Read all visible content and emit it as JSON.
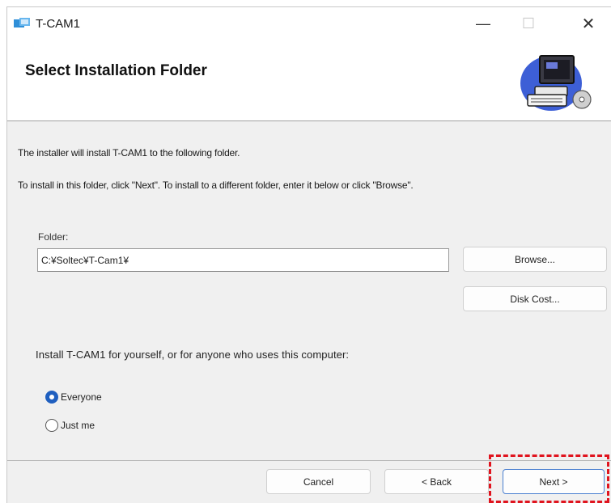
{
  "window": {
    "title": "T-CAM1",
    "minimize_glyph": "—",
    "maximize_glyph": "☐",
    "close_glyph": "✕"
  },
  "header": {
    "title": "Select Installation Folder",
    "art_icon": "computer-cd-icon"
  },
  "body": {
    "intro": "The installer will install T-CAM1 to the following folder.",
    "instructions": "To install in this folder, click \"Next\". To install to a different folder, enter it below or click \"Browse\"."
  },
  "folder": {
    "label": "Folder:",
    "value": "C:¥Soltec¥T-Cam1¥"
  },
  "buttons": {
    "browse": "Browse...",
    "disk_cost": "Disk Cost...",
    "cancel": "Cancel",
    "back": "< Back",
    "next": "Next >"
  },
  "install_for": {
    "prompt": "Install T-CAM1 for yourself, or for anyone who uses this computer:",
    "options": [
      {
        "label": "Everyone",
        "selected": true
      },
      {
        "label": "Just me",
        "selected": false
      }
    ]
  },
  "colors": {
    "accent": "#1f5fbf",
    "highlight": "#e0141e",
    "dialog_bg": "#f0f0f0"
  }
}
